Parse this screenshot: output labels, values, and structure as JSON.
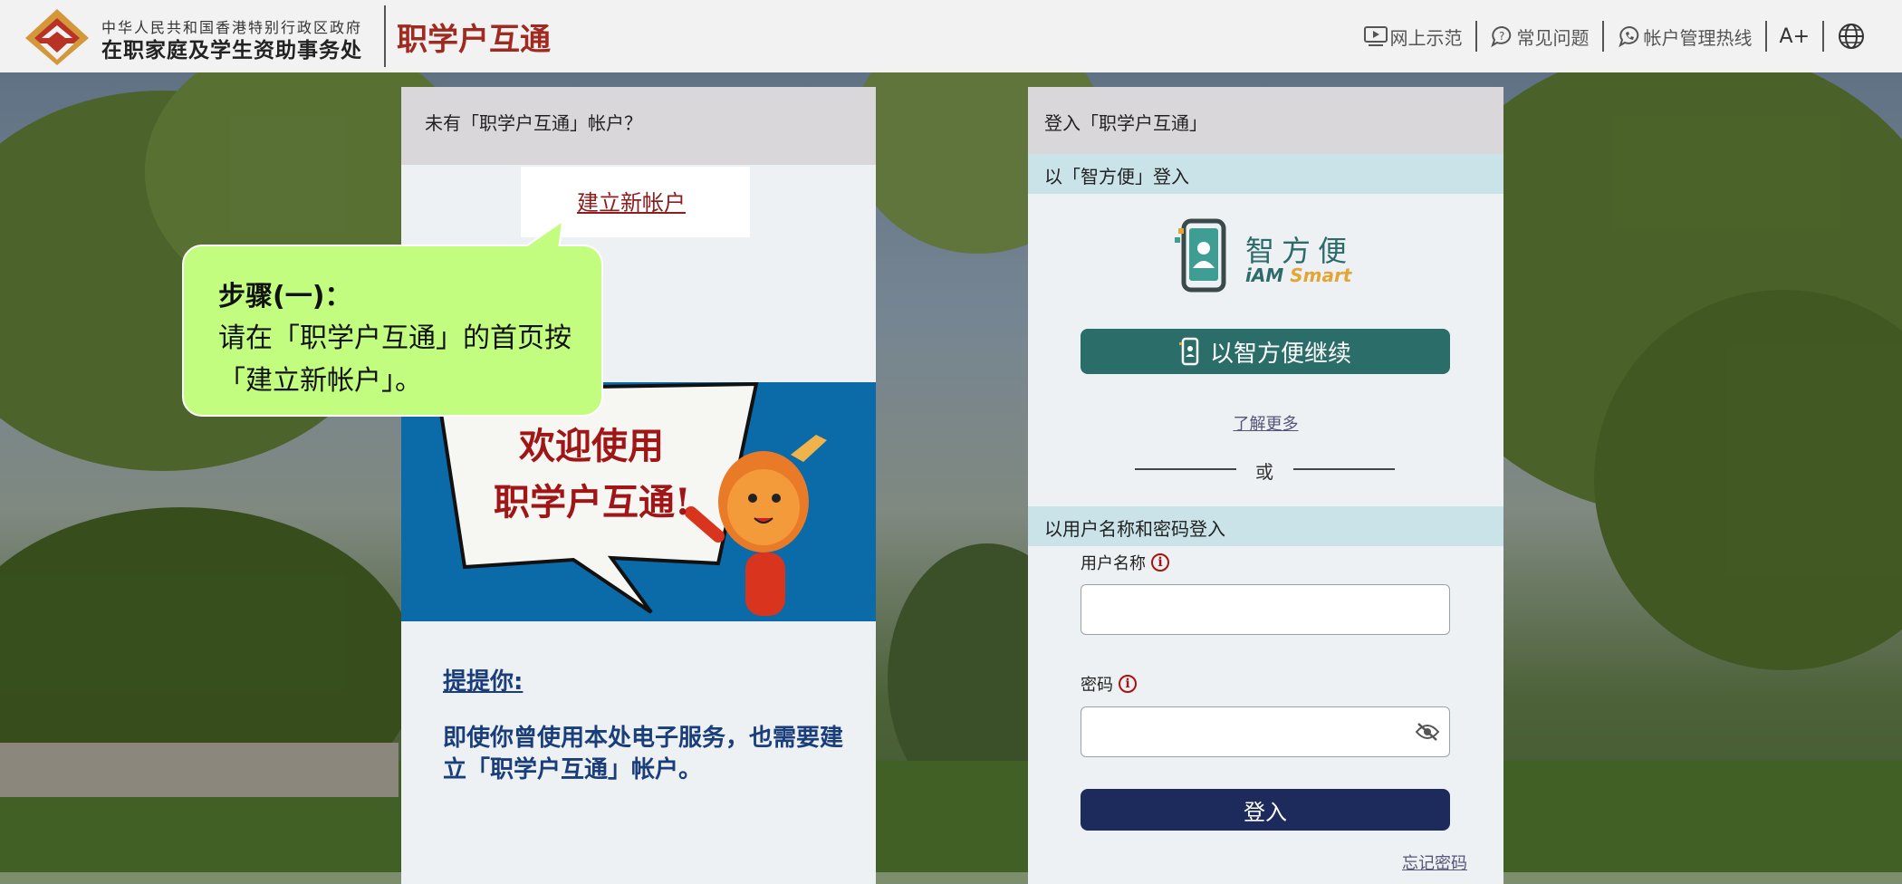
{
  "header": {
    "dept_small": "中华人民共和国香港特别行政区政府",
    "dept_name": "在职家庭及学生资助事务处",
    "app_title": "职学户互通",
    "nav": {
      "demo": "网上示范",
      "faq": "常见问题",
      "hotline": "帐户管理热线",
      "font_size": "A+"
    }
  },
  "register_card": {
    "heading": "未有「职学户互通」帐户？",
    "create_link": "建立新帐户",
    "banner_line1": "欢迎使用",
    "banner_line2": "职学户互通!",
    "tip_title": "提提你:",
    "tip_body": "即使你曾使用本处电子服务，也需要建立「职学户互通」帐户。"
  },
  "login_card": {
    "heading": "登入「职学户互通」",
    "iam_section": "以「智方便」登入",
    "iam_logo_cn": "智方便",
    "iam_logo_en_a": "iAM ",
    "iam_logo_en_b": "Smart",
    "iam_button": "以智方便继续",
    "learn_more": "了解更多",
    "or": "或",
    "password_section": "以用户名称和密码登入",
    "username_label": "用户名称",
    "password_label": "密码",
    "login_button": "登入",
    "forgot_password": "忘记密码"
  },
  "callout": {
    "title": "步骤(一)：",
    "body": "请在「职学户互通」的首页按「建立新帐户」。"
  },
  "colors": {
    "accent_red": "#a02a1f",
    "iam_green": "#2a6d69",
    "login_navy": "#1d2a5c",
    "callout_green": "#c2fd80",
    "section_bar": "#c9e3e8"
  },
  "icons": [
    "video-play-icon",
    "question-bubble-icon",
    "phone-bubble-icon",
    "globe-icon",
    "phone-iam-icon",
    "eye-slash-icon",
    "info-icon"
  ]
}
